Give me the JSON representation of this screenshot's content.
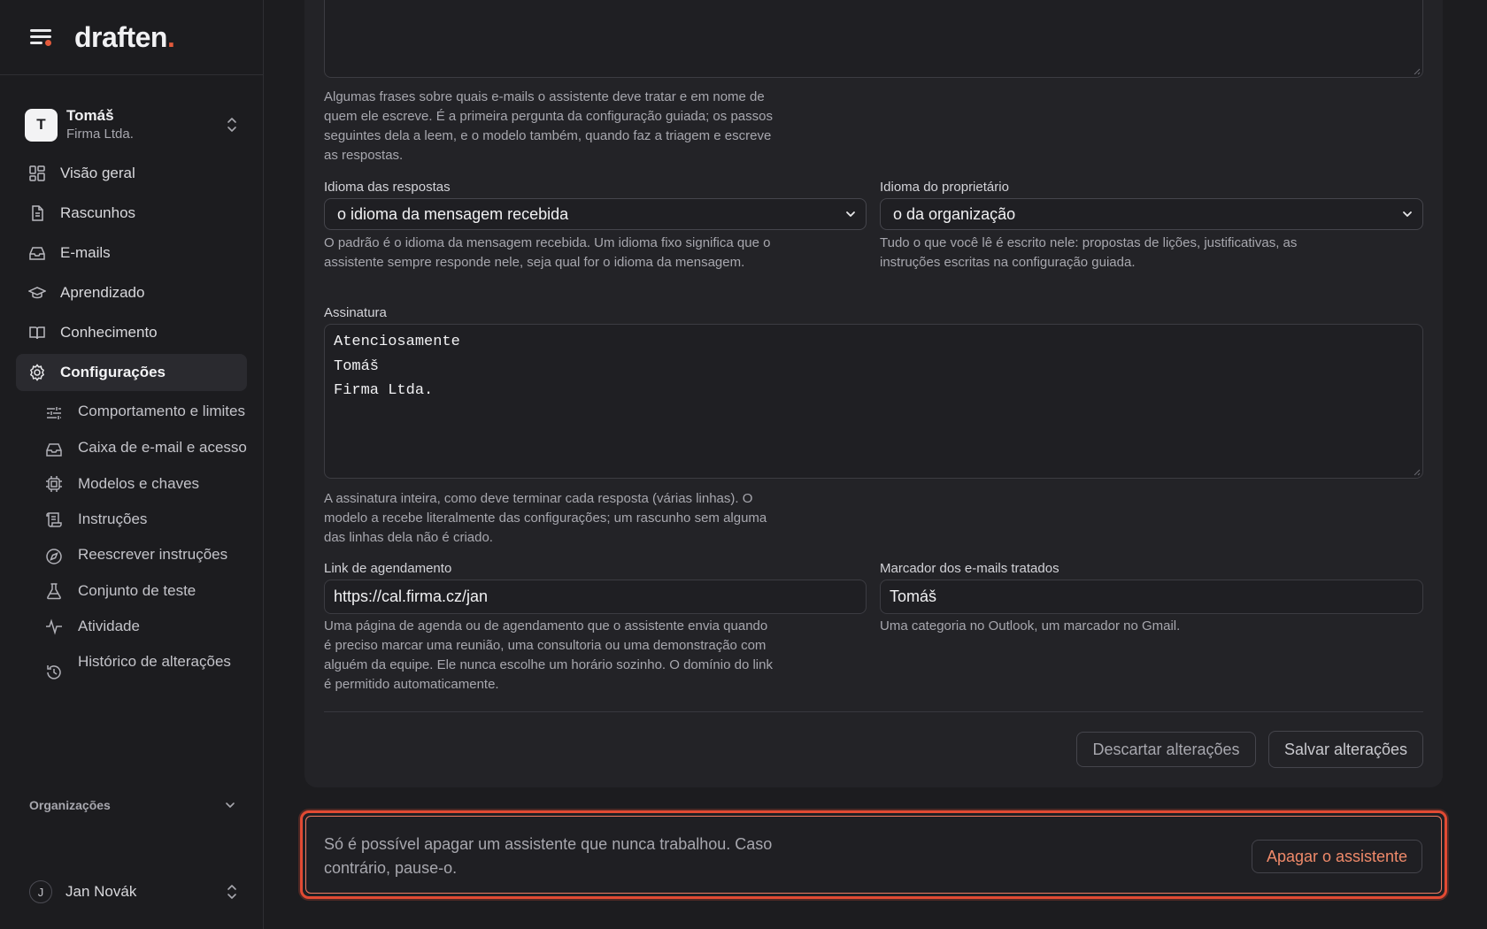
{
  "brand": {
    "logo": "draften",
    "logo_dot": "."
  },
  "account": {
    "initial": "T",
    "name": "Tomáš",
    "company": "Firma Ltda."
  },
  "nav": [
    {
      "label": "Visão geral",
      "icon": "dashboard-icon"
    },
    {
      "label": "Rascunhos",
      "icon": "document-icon"
    },
    {
      "label": "E-mails",
      "icon": "inbox-icon"
    },
    {
      "label": "Aprendizado",
      "icon": "graduation-cap-icon"
    },
    {
      "label": "Conhecimento",
      "icon": "book-icon"
    },
    {
      "label": "Configurações",
      "icon": "gear-icon",
      "active": true
    }
  ],
  "subnav": [
    {
      "label": "Comportamento e limites",
      "icon": "sliders-icon"
    },
    {
      "label": "Caixa de e-mail e acesso",
      "icon": "inbox-icon"
    },
    {
      "label": "Modelos e chaves",
      "icon": "chip-icon"
    },
    {
      "label": "Instruções",
      "icon": "scroll-icon"
    },
    {
      "label": "Reescrever instruções",
      "icon": "compass-icon"
    },
    {
      "label": "Conjunto de teste",
      "icon": "flask-icon"
    },
    {
      "label": "Atividade",
      "icon": "activity-icon"
    },
    {
      "label": "Histórico de alterações",
      "icon": "history-icon"
    }
  ],
  "organizations": {
    "label": "Organizações"
  },
  "user": {
    "initial": "J",
    "name": "Jan Novák"
  },
  "form": {
    "scope_help": "Algumas frases sobre quais e-mails o assistente deve tratar e em nome de quem ele escreve. É a primeira pergunta da configuração guiada; os passos seguintes dela a leem, e o modelo também, quando faz a triagem e escreve as respostas.",
    "reply_language": {
      "label": "Idioma das respostas",
      "value": "o idioma da mensagem recebida",
      "help": "O padrão é o idioma da mensagem recebida. Um idioma fixo significa que o assistente sempre responde nele, seja qual for o idioma da mensagem."
    },
    "owner_language": {
      "label": "Idioma do proprietário",
      "value": "o da organização",
      "help": "Tudo o que você lê é escrito nele: propostas de lições, justificativas, as instruções escritas na configuração guiada."
    },
    "signature": {
      "label": "Assinatura",
      "lines": [
        "Atenciosamente",
        "Tomáš",
        "Firma Ltda."
      ],
      "help": "A assinatura inteira, como deve terminar cada resposta (várias linhas). O modelo a recebe literalmente das configurações; um rascunho sem alguma das linhas dela não é criado."
    },
    "booking_link": {
      "label": "Link de agendamento",
      "value": "https://cal.firma.cz/jan",
      "help": "Uma página de agenda ou de agendamento que o assistente envia quando é preciso marcar uma reunião, uma consultoria ou uma demonstração com alguém da equipe. Ele nunca escolhe um horário sozinho. O domínio do link é permitido automaticamente."
    },
    "handled_marker": {
      "label": "Marcador dos e-mails tratados",
      "value": "Tomáš",
      "help": "Uma categoria no Outlook, um marcador no Gmail."
    },
    "discard_label": "Descartar alterações",
    "save_label": "Salvar alterações"
  },
  "danger": {
    "text": "Só é possível apagar um assistente que nunca trabalhou. Caso contrário, pause-o.",
    "button": "Apagar o assistente"
  },
  "colors": {
    "accent": "#e25a3c",
    "danger_border": "#e24a33",
    "danger_text": "#f08a6a",
    "background": "#1c1c1f",
    "card": "#232327"
  }
}
